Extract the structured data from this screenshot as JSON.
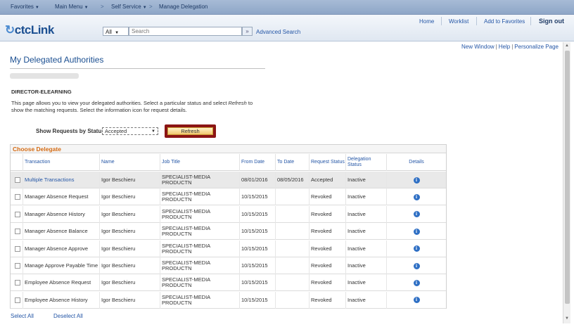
{
  "topnav": {
    "favorites": "Favorites",
    "main_menu": "Main Menu",
    "self_service": "Self Service",
    "manage_delegation": "Manage Delegation"
  },
  "header": {
    "logo_prefix": "ctc",
    "logo_suffix": "Link",
    "search_scope": "All",
    "search_placeholder": "Search",
    "search_go": "»",
    "advanced_search": "Advanced Search",
    "home": "Home",
    "worklist": "Worklist",
    "add_to_favorites": "Add to Favorites",
    "sign_out": "Sign out"
  },
  "toplinks": {
    "new_window": "New Window",
    "help": "Help",
    "personalize_page": "Personalize Page"
  },
  "page": {
    "title": "My Delegated Authorities",
    "section": "DIRECTOR-ELEARNING",
    "instructions_1": "This page allows you to view your delegated authorities. Select a particular status and select ",
    "instructions_refresh": "Refresh",
    "instructions_2": " to show the matching requests. Select the information icon for request details.",
    "status_label": "Show Requests by Status",
    "status_value": "Accepted",
    "refresh_button": "Refresh"
  },
  "grid": {
    "title": "Choose Delegate",
    "headers": {
      "transaction": "Transaction",
      "name": "Name",
      "job_title": "Job Title",
      "from_date": "From Date",
      "to_date": "To Date",
      "request_status": "Request Status",
      "delegation_status": "Delegation Status",
      "details": "Details"
    },
    "rows": [
      {
        "transaction": "Multiple Transactions",
        "name": "Igor Beschieru",
        "job_title": "SPECIALIST-MEDIA PRODUCTN",
        "from_date": "08/01/2016",
        "to_date": "08/05/2016",
        "request_status": "Accepted",
        "delegation_status": "Inactive"
      },
      {
        "transaction": "Manager Absence Request",
        "name": "Igor Beschieru",
        "job_title": "SPECIALIST-MEDIA PRODUCTN",
        "from_date": "10/15/2015",
        "to_date": "",
        "request_status": "Revoked",
        "delegation_status": "Inactive"
      },
      {
        "transaction": "Manager Absence History",
        "name": "Igor Beschieru",
        "job_title": "SPECIALIST-MEDIA PRODUCTN",
        "from_date": "10/15/2015",
        "to_date": "",
        "request_status": "Revoked",
        "delegation_status": "Inactive"
      },
      {
        "transaction": "Manager Absence Balance",
        "name": "Igor Beschieru",
        "job_title": "SPECIALIST-MEDIA PRODUCTN",
        "from_date": "10/15/2015",
        "to_date": "",
        "request_status": "Revoked",
        "delegation_status": "Inactive"
      },
      {
        "transaction": "Manager Absence Approve",
        "name": "Igor Beschieru",
        "job_title": "SPECIALIST-MEDIA PRODUCTN",
        "from_date": "10/15/2015",
        "to_date": "",
        "request_status": "Revoked",
        "delegation_status": "Inactive"
      },
      {
        "transaction": "Manage Approve Payable Time",
        "name": "Igor Beschieru",
        "job_title": "SPECIALIST-MEDIA PRODUCTN",
        "from_date": "10/15/2015",
        "to_date": "",
        "request_status": "Revoked",
        "delegation_status": "Inactive"
      },
      {
        "transaction": "Employee Absence Request",
        "name": "Igor Beschieru",
        "job_title": "SPECIALIST-MEDIA PRODUCTN",
        "from_date": "10/15/2015",
        "to_date": "",
        "request_status": "Revoked",
        "delegation_status": "Inactive"
      },
      {
        "transaction": "Employee Absence History",
        "name": "Igor Beschieru",
        "job_title": "SPECIALIST-MEDIA PRODUCTN",
        "from_date": "10/15/2015",
        "to_date": "",
        "request_status": "Revoked",
        "delegation_status": "Inactive"
      }
    ],
    "info_glyph": "i"
  },
  "footer": {
    "select_all": "Select All",
    "deselect_all": "Deselect All"
  }
}
